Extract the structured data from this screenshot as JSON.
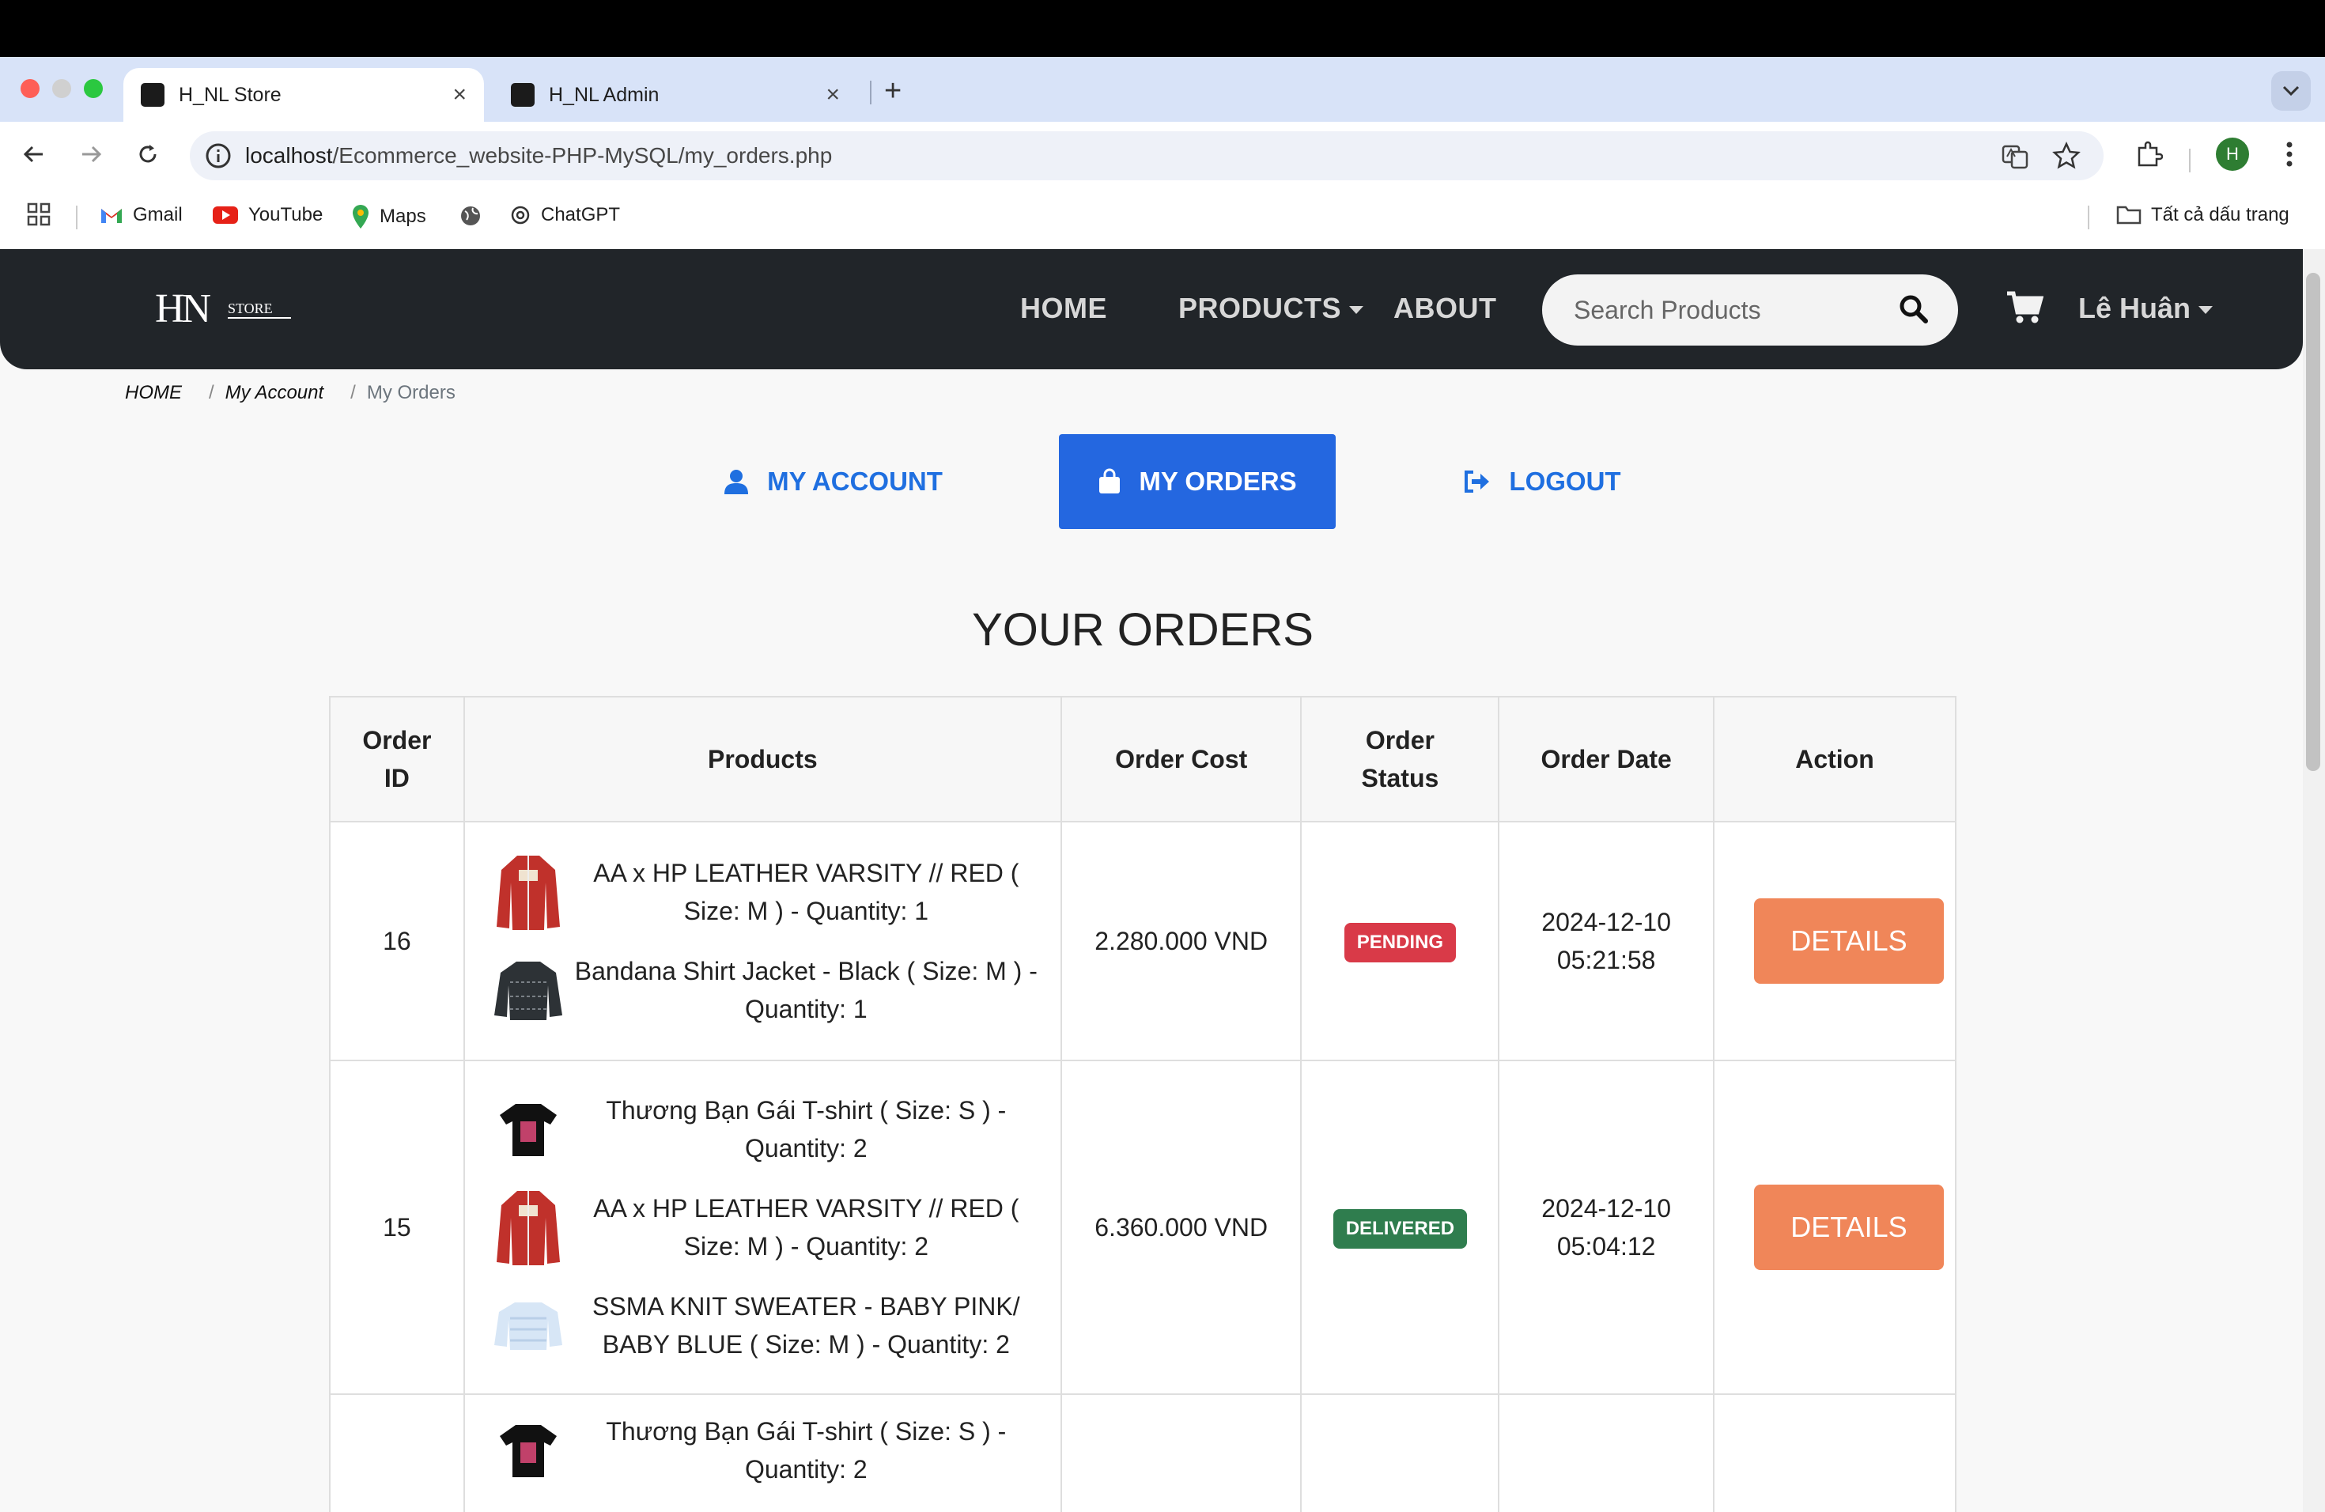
{
  "browser": {
    "tabs": [
      {
        "title": "H_NL Store",
        "active": true
      },
      {
        "title": "H_NL Admin",
        "active": false
      }
    ],
    "url_host": "localhost",
    "url_path": "/Ecommerce_website-PHP-MySQL/my_orders.php",
    "bookmarks": [
      "Gmail",
      "YouTube",
      "Maps",
      "ChatGPT"
    ],
    "all_bookmarks": "Tất cả dấu trang",
    "profile_initial": "H"
  },
  "site": {
    "logo_main": "HN",
    "logo_sub": "STORE",
    "nav": {
      "home": "HOME",
      "products": "PRODUCTS",
      "about": "ABOUT"
    },
    "search_placeholder": "Search Products",
    "user_name": "Lê Huân"
  },
  "breadcrumb": {
    "home": "HOME",
    "account": "My Account",
    "current": "My Orders",
    "sep": "/"
  },
  "account_nav": {
    "my_account": "MY ACCOUNT",
    "my_orders": "MY ORDERS",
    "logout": "LOGOUT"
  },
  "orders": {
    "heading": "YOUR ORDERS",
    "columns": {
      "order_id_1": "Order",
      "order_id_2": "ID",
      "products": "Products",
      "cost": "Order Cost",
      "status_1": "Order",
      "status_2": "Status",
      "date": "Order Date",
      "action": "Action"
    },
    "rows": [
      {
        "id": "16",
        "products": [
          "AA x HP LEATHER VARSITY // RED ( Size: M ) - Quantity: 1",
          "Bandana Shirt Jacket - Black ( Size: M ) - Quantity: 1"
        ],
        "cost": "2.280.000 VND",
        "status": "PENDING",
        "date_1": "2024-12-10",
        "date_2": "05:21:58",
        "action": "DETAILS"
      },
      {
        "id": "15",
        "products": [
          "Thương Bạn Gái T-shirt ( Size: S ) - Quantity: 2",
          "AA x HP LEATHER VARSITY // RED ( Size: M ) - Quantity: 2",
          "SSMA KNIT SWEATER - BABY PINK/ BABY BLUE ( Size: M ) - Quantity: 2"
        ],
        "cost": "6.360.000 VND",
        "status": "DELIVERED",
        "date_1": "2024-12-10",
        "date_2": "05:04:12",
        "action": "DETAILS"
      },
      {
        "products": [
          "Thương Bạn Gái T-shirt ( Size: S ) - Quantity: 2"
        ]
      }
    ]
  },
  "colors": {
    "navbar": "#212529",
    "primary": "#2467e0",
    "pending": "#d93a48",
    "delivered": "#2f7d4e",
    "details_button": "#f08659"
  }
}
